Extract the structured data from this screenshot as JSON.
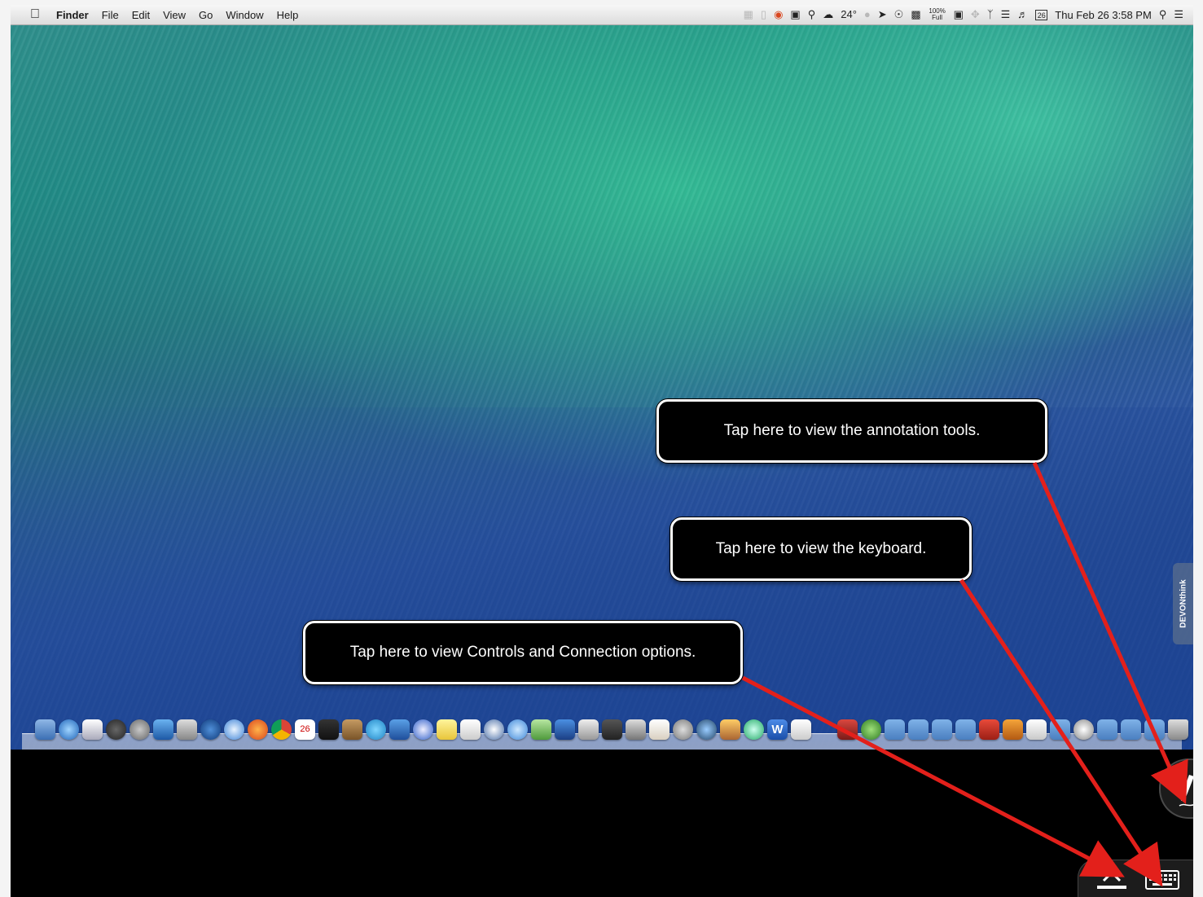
{
  "menubar": {
    "apple_icon": "apple-logo-icon",
    "app_name": "Finder",
    "menus": [
      "File",
      "Edit",
      "View",
      "Go",
      "Window",
      "Help"
    ],
    "weather_temp": "24°",
    "battery_text": "100% Full",
    "calendar_day": "26",
    "clock": "Thu Feb 26  3:58 PM"
  },
  "side_tab": {
    "label": "DEVONthink"
  },
  "callouts": {
    "annotation": "Tap here to view the annotation tools.",
    "keyboard": "Tap here to view the keyboard.",
    "controls": "Tap here to view Controls and Connection options."
  },
  "dock": {
    "calendar_day": "26"
  },
  "colors": {
    "arrow": "#e3201b",
    "callout_bg": "#000000",
    "callout_border": "#ffffff"
  }
}
